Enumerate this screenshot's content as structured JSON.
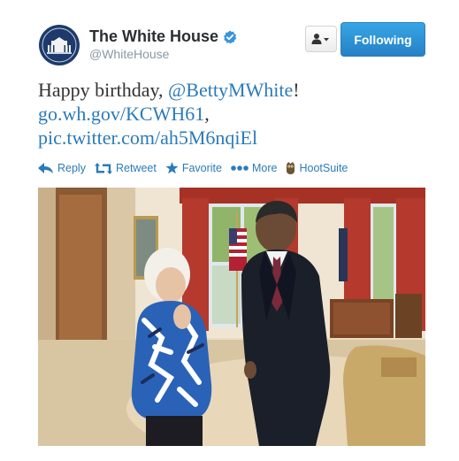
{
  "header": {
    "fullname": "The White House",
    "screenname": "@WhiteHouse",
    "verified": true,
    "follow_label": "Following",
    "avatar_icon": "white-house-seal-icon",
    "dropdown_icon": "user-dropdown-icon"
  },
  "tweet": {
    "line1_prefix": "Happy birthday, ",
    "mention": "@BettyMWhite",
    "line1_suffix": "!",
    "link": "go.wh.gov/KCWH61",
    "link_suffix": ",",
    "pic_link": "pic.twitter.com/ah5M6nqiEl"
  },
  "actions": [
    {
      "label": "Reply",
      "icon": "reply-icon"
    },
    {
      "label": "Retweet",
      "icon": "retweet-icon"
    },
    {
      "label": "Favorite",
      "icon": "star-icon"
    },
    {
      "label": "More",
      "icon": "more-dots-icon"
    },
    {
      "label": "HootSuite",
      "icon": "hootsuite-owl-icon"
    }
  ],
  "colors": {
    "link": "#2b7bb9",
    "follow_button": "#2681c6",
    "verified_badge": "#3b94d9",
    "drapes": "#b5392d",
    "carpet": "#e8d7b8"
  }
}
